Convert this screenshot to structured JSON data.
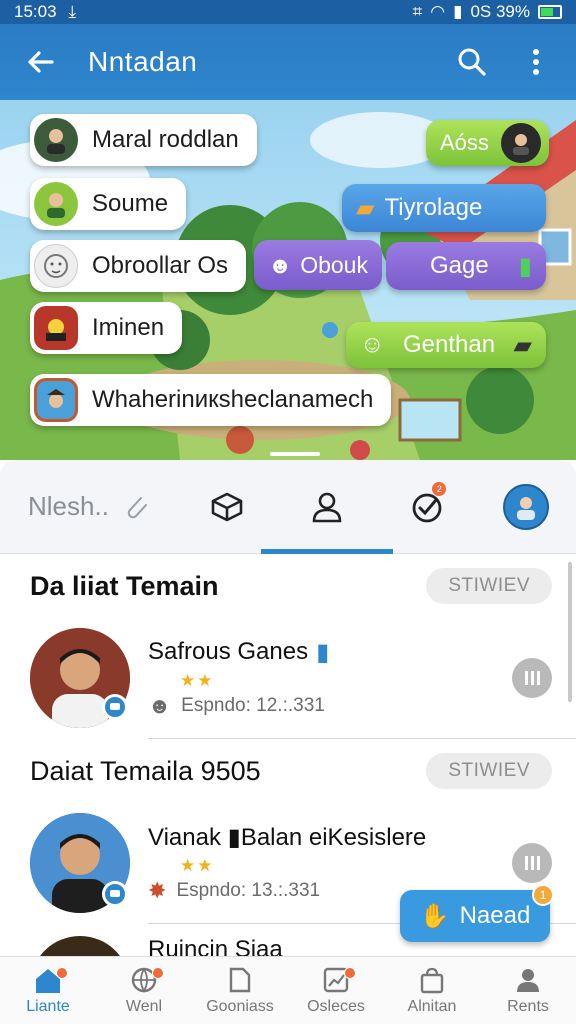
{
  "status_bar": {
    "time": "15:03",
    "battery_text": "0S 39%"
  },
  "app_bar": {
    "title": "Nntadan"
  },
  "hero": {
    "chips_left": [
      {
        "label": "Maral roddlan",
        "avatar": "avatar-man"
      },
      {
        "label": "Soume",
        "avatar": "avatar-green"
      },
      {
        "label": "Obroollar Os",
        "avatar": "avatar-lion"
      },
      {
        "label": "Iminen",
        "avatar": "avatar-game"
      },
      {
        "label": "Whaherinикsheclanamech",
        "avatar": "avatar-adventure"
      }
    ],
    "chip_obouk": "Obouk",
    "chip_aoss": "Aóss",
    "chip_tiyrolage": "Tiyrolage",
    "chip_gage": "Gage",
    "chip_genthan": "Genthan"
  },
  "tabs": {
    "search_placeholder": "Nlesh..",
    "notify_badge": "2"
  },
  "sections": [
    {
      "title": "Da liiat Temain",
      "pill": "STIWIEV",
      "row": {
        "name": "Safrous Ganes",
        "stars": "★★",
        "meta": "Espndo: 12.:.331"
      }
    },
    {
      "title": "Daiat Temaila  9505",
      "pill": "STIWIEV",
      "row": {
        "name": "Vianak ▮Balan eiKesislere",
        "stars": "★★",
        "meta": "Espndo: 13.:.331"
      }
    },
    {
      "title": "Ruincin Siaa"
    }
  ],
  "fab": {
    "label": "Naead",
    "badge": "1"
  },
  "bottom_nav": [
    {
      "label": "Liante",
      "active": true
    },
    {
      "label": "Wenl"
    },
    {
      "label": "Gooniass"
    },
    {
      "label": "Osleces"
    },
    {
      "label": "Alnitan"
    },
    {
      "label": "Rents"
    }
  ],
  "colors": {
    "primary": "#2e86cc",
    "status_bar": "#1d5fa3",
    "badge": "#f06a3a",
    "star": "#f2b21c"
  }
}
